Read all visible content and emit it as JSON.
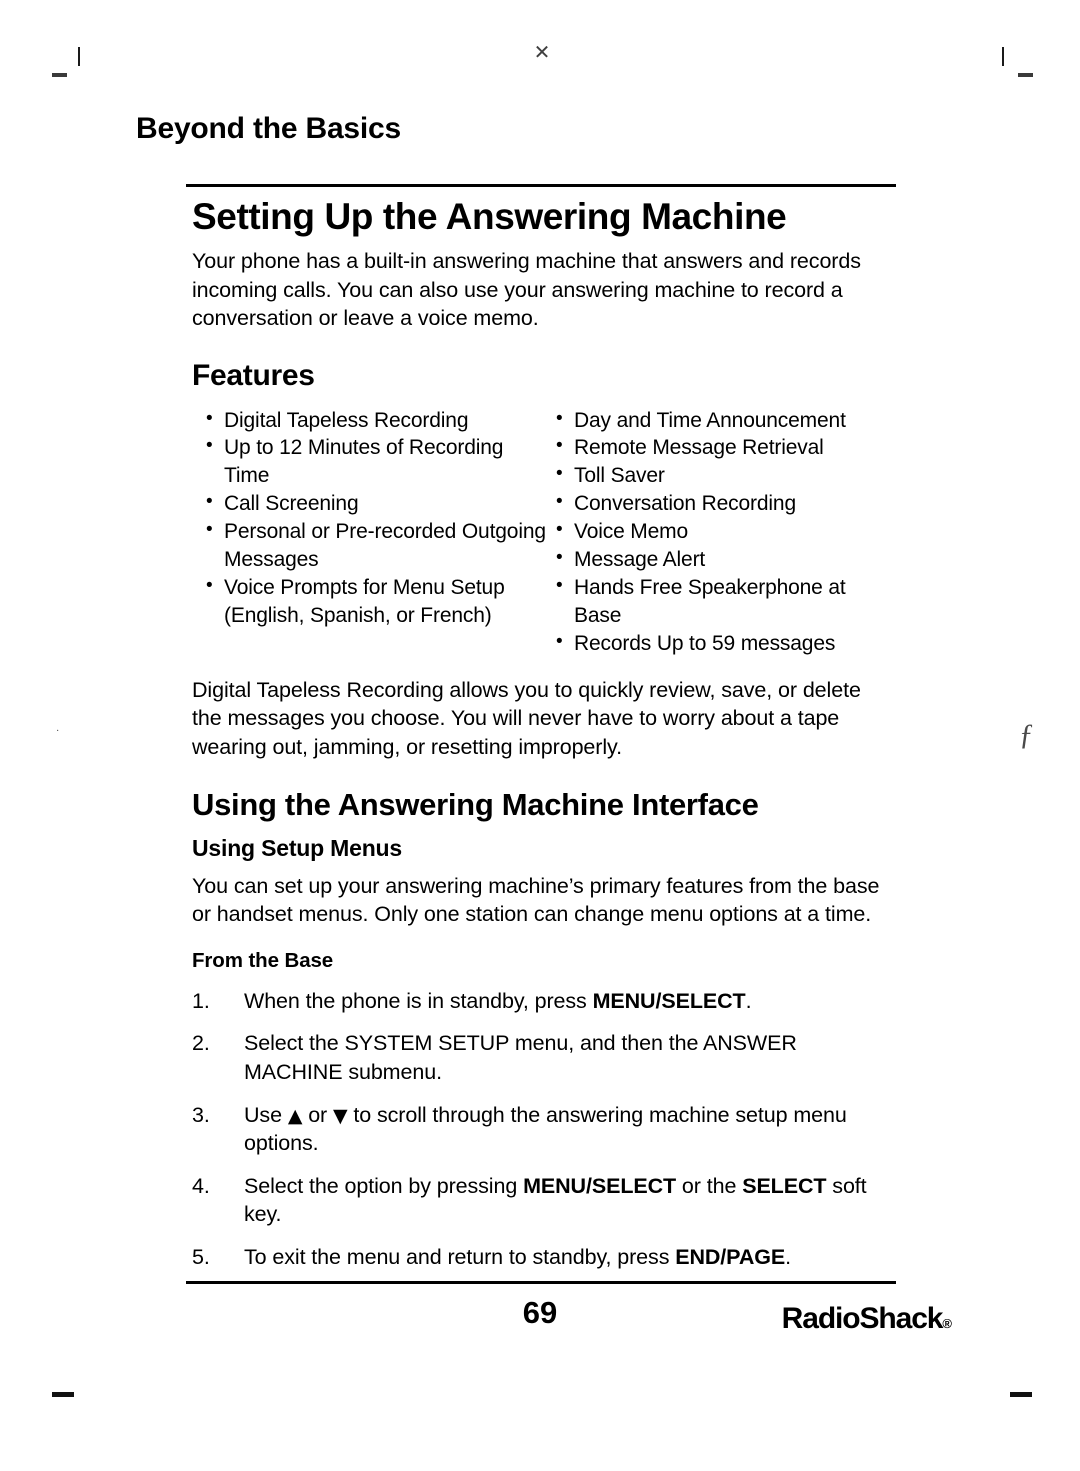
{
  "running_head": "Beyond the Basics",
  "chapter_title": "Setting Up the Answering Machine",
  "intro_paragraph": "Your phone has a built-in answering machine that answers and records incoming calls. You can also use your answering machine to record a conversation or leave a voice memo.",
  "features": {
    "heading": "Features",
    "left_column": [
      "Digital Tapeless Recording",
      "Up to 12 Minutes of Recording Time",
      "Call Screening",
      "Personal or Pre-recorded Outgoing Messages",
      "Voice Prompts for Menu Setup (English, Spanish, or French)"
    ],
    "right_column": [
      "Day and Time Announcement",
      "Remote Message Retrieval",
      "Toll Saver",
      "Conversation Recording",
      "Voice Memo",
      "Message Alert",
      "Hands Free Speakerphone at Base",
      "Records Up to 59 messages"
    ]
  },
  "tapeless_paragraph": "Digital Tapeless Recording allows you to quickly review, save, or delete the messages you choose. You will never have to worry about a tape wearing out, jamming, or resetting improperly.",
  "interface": {
    "heading": "Using the Answering Machine Interface",
    "subheading": "Using Setup Menus",
    "paragraph": "You can set up your answering machine’s primary features from the base or handset menus. Only one station can change menu options at a time.",
    "from_base_heading": "From the Base",
    "steps": [
      {
        "number": "1.",
        "parts": [
          {
            "text": "When the phone is in standby, press ",
            "bold": false
          },
          {
            "text": "MENU/SELECT",
            "bold": true
          },
          {
            "text": ".",
            "bold": false
          }
        ]
      },
      {
        "number": "2.",
        "parts": [
          {
            "text": "Select the SYSTEM SETUP menu, and then the ANSWER MACHINE submenu.",
            "bold": false
          }
        ]
      },
      {
        "number": "3.",
        "parts": [
          {
            "text": "Use ",
            "bold": false
          },
          {
            "text": "▲",
            "bold": false,
            "glyph": true
          },
          {
            "text": " or ",
            "bold": false
          },
          {
            "text": "▼",
            "bold": false,
            "glyph": true
          },
          {
            "text": " to scroll through the answering machine setup menu options.",
            "bold": false
          }
        ]
      },
      {
        "number": "4.",
        "parts": [
          {
            "text": "Select the option by pressing ",
            "bold": false
          },
          {
            "text": "MENU/SELECT",
            "bold": true
          },
          {
            "text": " or the ",
            "bold": false
          },
          {
            "text": "SELECT",
            "bold": true
          },
          {
            "text": " soft key.",
            "bold": false
          }
        ]
      },
      {
        "number": "5.",
        "parts": [
          {
            "text": "To exit the menu and return to standby, press ",
            "bold": false
          },
          {
            "text": "END/PAGE",
            "bold": true
          },
          {
            "text": ".",
            "bold": false
          }
        ]
      }
    ]
  },
  "footer": {
    "page_number": "69",
    "brand": "RadioShack",
    "brand_mark": "®"
  },
  "marks": {
    "registration_cross": "✕",
    "margin_artifact": "ƒ"
  },
  "colors": {
    "ink": "#000000",
    "paper": "#ffffff",
    "mark": "#3a3a3a"
  }
}
